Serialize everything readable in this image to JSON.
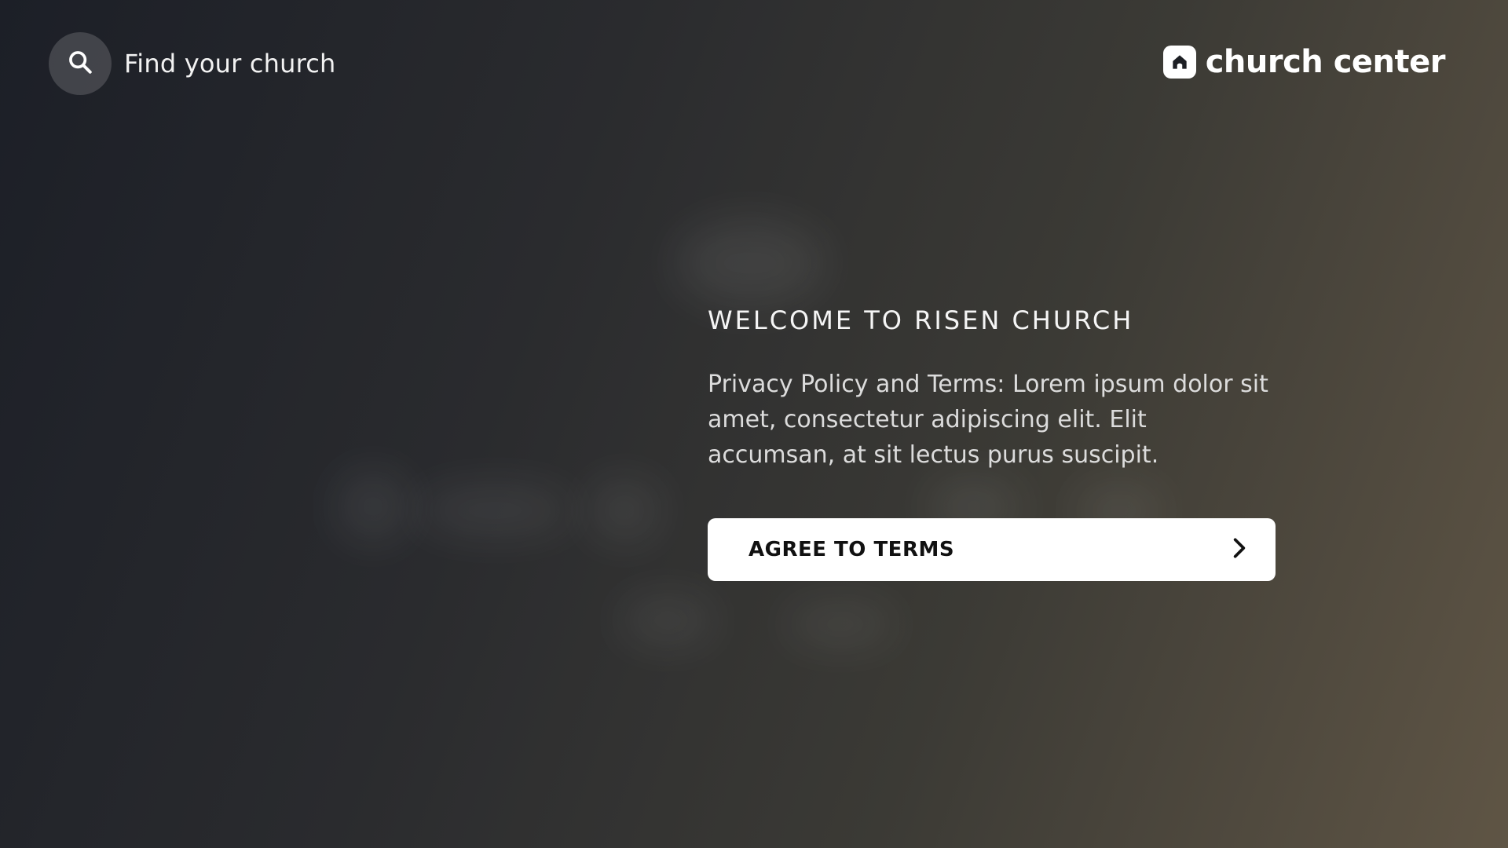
{
  "search": {
    "label": "Find your church",
    "icon": "search-icon"
  },
  "brand": {
    "name": "church center",
    "icon": "church-home-icon"
  },
  "welcome": {
    "title": "WELCOME TO RISEN CHURCH",
    "body": "Privacy Policy and Terms: Lorem ipsum dolor sit amet, consectetur adipiscing elit. Elit accumsan, at sit lectus purus suscipit."
  },
  "agree_button": {
    "label": "AGREE TO TERMS",
    "icon": "chevron-right-icon"
  },
  "colors": {
    "background_start": "#1c1f27",
    "background_end": "#5f5545",
    "button_bg": "#ffffff",
    "button_text": "#111111"
  }
}
